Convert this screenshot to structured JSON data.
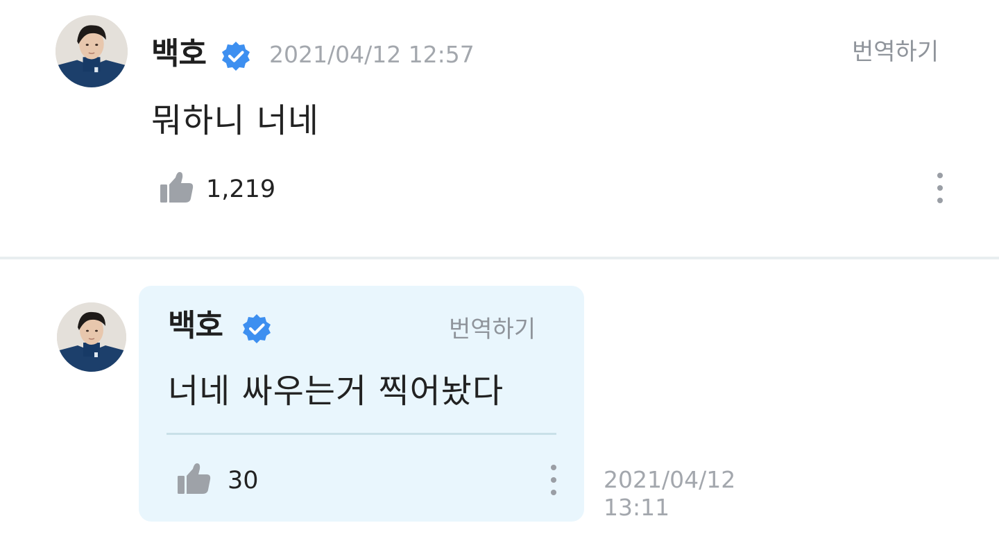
{
  "colors": {
    "verified_badge": "#3d8ff0",
    "timestamp": "#a3a7ad",
    "bubble_background": "#e9f6fd",
    "like_icon": "#9ea2a8"
  },
  "post": {
    "author": "백호",
    "verified_icon": "verified-badge-icon",
    "timestamp": "2021/04/12 12:57",
    "translate_label": "번역하기",
    "message": "뭐하니 너네",
    "like_icon": "thumbs-up-icon",
    "like_count": "1,219",
    "more_icon": "more-vertical-icon"
  },
  "reply": {
    "author": "백호",
    "verified_icon": "verified-badge-icon",
    "translate_label": "번역하기",
    "message": "너네 싸우는거 찍어놨다",
    "like_icon": "thumbs-up-icon",
    "like_count": "30",
    "more_icon": "more-vertical-icon",
    "timestamp_date": "2021/04/12",
    "timestamp_time": "13:11"
  }
}
